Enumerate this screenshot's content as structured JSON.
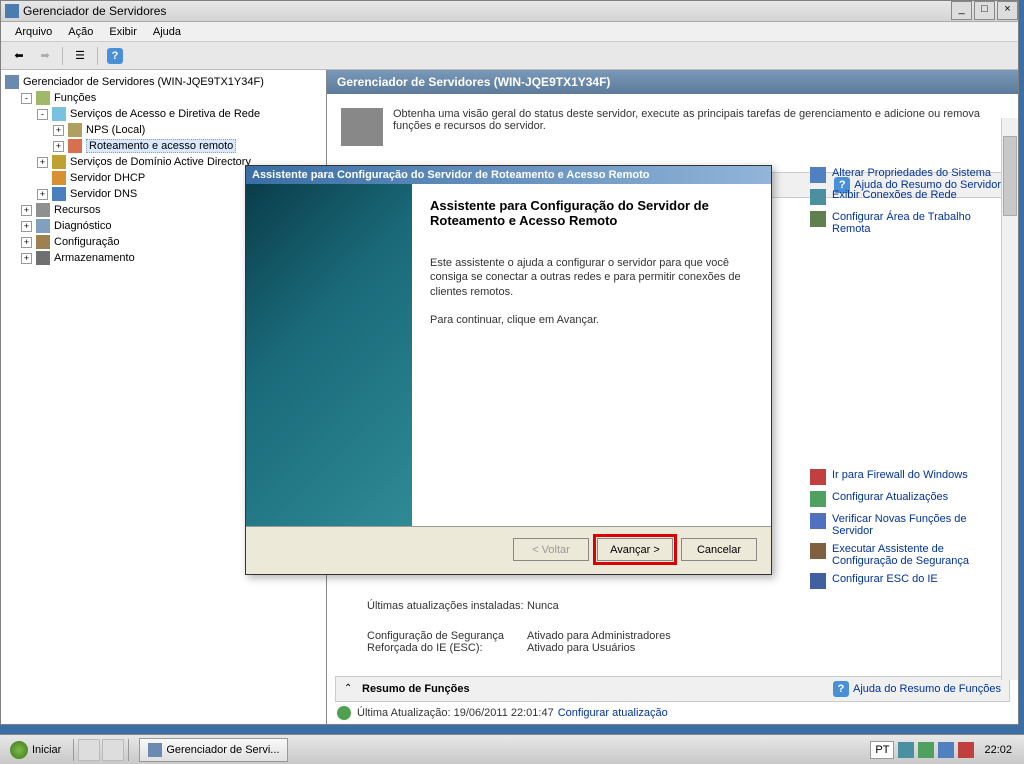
{
  "window": {
    "title": "Gerenciador de Servidores",
    "min": "_",
    "max": "□",
    "close": "×"
  },
  "menu": {
    "arquivo": "Arquivo",
    "acao": "Ação",
    "exibir": "Exibir",
    "ajuda": "Ajuda"
  },
  "tree": {
    "root": "Gerenciador de Servidores (WIN-JQE9TX1Y34F)",
    "funcoes": "Funções",
    "acesso": "Serviços de Acesso e Diretiva de Rede",
    "nps": "NPS (Local)",
    "rras": "Roteamento e acesso remoto",
    "ad": "Serviços de Domínio Active Directory",
    "dhcp": "Servidor DHCP",
    "dns": "Servidor DNS",
    "recursos": "Recursos",
    "diag": "Diagnóstico",
    "conf": "Configuração",
    "armaz": "Armazenamento"
  },
  "panel": {
    "header": "Gerenciador de Servidores (WIN-JQE9TX1Y34F)",
    "overview": "Obtenha uma visão geral do status deste servidor, execute as principais tarefas de gerenciamento e adicione ou remova funções e recursos do servidor."
  },
  "section_server": {
    "help": "Ajuda do Resumo do Servidor"
  },
  "right1": {
    "l1": "Alterar Propriedades do Sistema",
    "l2": "Exibir Conexões de Rede",
    "l3": "Configurar Área de Trabalho Remota"
  },
  "right2": {
    "l1": "Ir para Firewall do Windows",
    "l2": "Configurar Atualizações",
    "l3": "Verificar Novas Funções de Servidor",
    "l4": "Executar Assistente de Configuração de Segurança",
    "l5": "Configurar ESC do IE"
  },
  "info": {
    "updates_label": "Últimas atualizações instaladas:",
    "updates_value": "Nunca",
    "esc_label": "Configuração de Segurança Reforçada do IE (ESC):",
    "esc_value1": "Ativado para Administradores",
    "esc_value2": "Ativado para Usuários"
  },
  "section_roles": {
    "title": "Resumo de Funções",
    "help": "Ajuda do Resumo de Funções"
  },
  "footer": {
    "text": "Última Atualização: 19/06/2011 22:01:47",
    "link": "Configurar atualização"
  },
  "wizard": {
    "title": "Assistente para Configuração do Servidor de Roteamento e Acesso Remoto",
    "heading": "Assistente para Configuração do Servidor de Roteamento e Acesso Remoto",
    "p1": "Este assistente o ajuda a configurar o servidor para que você consiga se conectar a outras redes e para permitir conexões de clientes remotos.",
    "p2": "Para continuar, clique em Avançar.",
    "back": "< Voltar",
    "next": "Avançar >",
    "cancel": "Cancelar"
  },
  "taskbar": {
    "start": "Iniciar",
    "task": "Gerenciador de Servi...",
    "lang": "PT",
    "clock": "22:02"
  }
}
